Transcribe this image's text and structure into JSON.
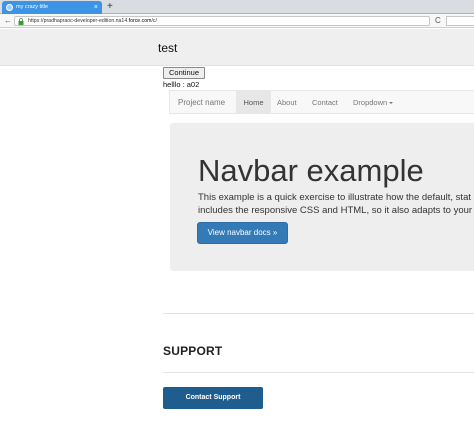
{
  "browser": {
    "tab_title": "my crazy title",
    "tab_close": "×",
    "new_tab": "+",
    "url_prefix": "https://pradhapraoc-developer-edition.na14.",
    "url_host": "force.com",
    "url_suffix": "/c/",
    "back": "←",
    "refresh": "C"
  },
  "page": {
    "title": "test",
    "continue_label": "Continue",
    "hello_text": "helllo : a02"
  },
  "navbar": {
    "brand": "Project name",
    "items": [
      {
        "label": "Home",
        "active": true
      },
      {
        "label": "About",
        "active": false
      },
      {
        "label": "Contact",
        "active": false
      },
      {
        "label": "Dropdown",
        "active": false
      }
    ]
  },
  "jumbotron": {
    "title": "Navbar example",
    "line1": "This example is a quick exercise to illustrate how the default, stat",
    "line2": "includes the responsive CSS and HTML, so it also adapts to your",
    "button_label": "View navbar docs »"
  },
  "support": {
    "heading": "SUPPORT",
    "button_label": "Contact Support"
  },
  "colors": {
    "primary_button": "#337ab7",
    "support_button": "#1f5d8e",
    "tab_active": "#3d94e4"
  }
}
